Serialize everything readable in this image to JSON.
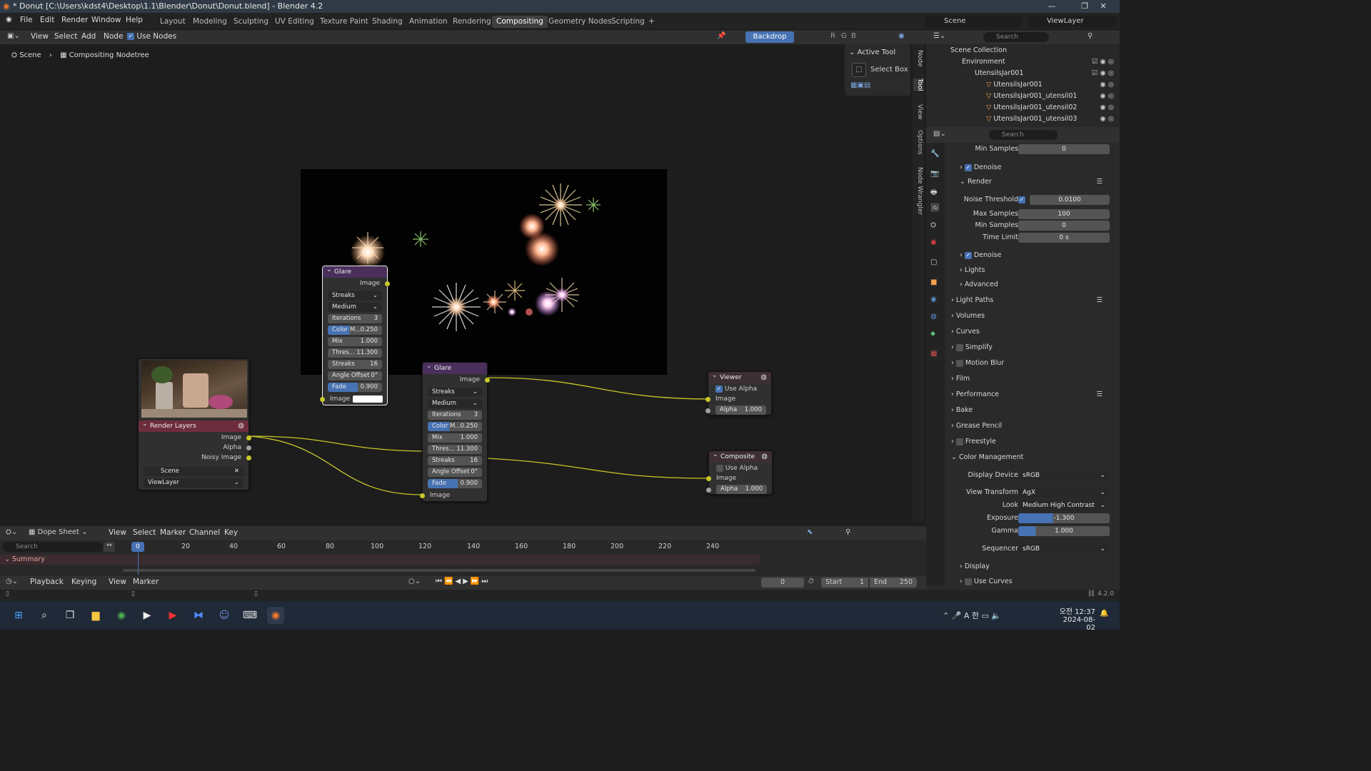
{
  "window": {
    "title": "* Donut [C:\\Users\\kdst4\\Desktop\\1.1\\Blender\\Donut\\Donut.blend] - Blender 4.2"
  },
  "menu": [
    "File",
    "Edit",
    "Render",
    "Window",
    "Help"
  ],
  "workspaces": [
    "Layout",
    "Modeling",
    "Sculpting",
    "UV Editing",
    "Texture Paint",
    "Shading",
    "Animation",
    "Rendering",
    "Compositing",
    "Geometry Nodes",
    "Scripting"
  ],
  "active_workspace": "Compositing",
  "scene_field": "Scene",
  "viewlayer_field": "ViewLayer",
  "editor_header": {
    "view": "View",
    "select": "Select",
    "add": "Add",
    "node": "Node",
    "use_nodes": "Use Nodes",
    "backdrop": "Backdrop",
    "channels": [
      "R",
      "G",
      "B"
    ]
  },
  "breadcrumb": {
    "scene": "Scene",
    "tree": "Compositing Nodetree"
  },
  "active_tool": {
    "title": "Active Tool",
    "tool": "Select Box"
  },
  "side_tabs": [
    "Node",
    "Tool",
    "View",
    "Options",
    "Node Wrangler"
  ],
  "glare_node": {
    "title": "Glare",
    "output": "Image",
    "type": "Streaks",
    "quality": "Medium",
    "fields": [
      {
        "label": "Iterations",
        "value": "3"
      },
      {
        "label": "Color M...",
        "value": "0.250",
        "blue": true
      },
      {
        "label": "Mix",
        "value": "1.000"
      },
      {
        "label": "Thres...",
        "value": "11.300"
      },
      {
        "label": "Streaks",
        "value": "16"
      },
      {
        "label": "Angle Offset",
        "value": "0°"
      },
      {
        "label": "Fade",
        "value": "0.900",
        "blue": true
      }
    ],
    "input": "Image"
  },
  "render_layers": {
    "title": "Render Layers",
    "outputs": [
      "Image",
      "Alpha",
      "Noisy Image"
    ],
    "scene": "Scene",
    "layer": "ViewLayer"
  },
  "viewer": {
    "title": "Viewer",
    "use_alpha": "Use Alpha",
    "image": "Image",
    "alpha_label": "Alpha",
    "alpha": "1.000"
  },
  "composite": {
    "title": "Composite",
    "use_alpha": "Use Alpha",
    "image": "Image",
    "alpha_label": "Alpha",
    "alpha": "1.000"
  },
  "outliner": {
    "search": "Search",
    "rows": [
      {
        "name": "Scene Collection"
      },
      {
        "name": "Environment"
      },
      {
        "name": "UtensilsJar001"
      },
      {
        "name": "UtensilsJar001"
      },
      {
        "name": "UtensilsJar001_utensil01"
      },
      {
        "name": "UtensilsJar001_utensil02"
      },
      {
        "name": "UtensilsJar001_utensil03"
      }
    ]
  },
  "properties": {
    "search": "Search",
    "rows": [
      {
        "label": "Min Samples",
        "value": "0"
      },
      {
        "label": "Denoise",
        "type": "check"
      },
      {
        "label": "Render",
        "type": "section"
      },
      {
        "label": "Noise Threshold",
        "value": "0.0100"
      },
      {
        "label": "Max Samples",
        "value": "100"
      },
      {
        "label": "Min Samples",
        "value": "0"
      },
      {
        "label": "Time Limit",
        "value": "0 s"
      },
      {
        "label": "Denoise",
        "type": "check"
      },
      {
        "label": "Lights",
        "type": "sub"
      },
      {
        "label": "Advanced",
        "type": "sub"
      },
      {
        "label": "Light Paths",
        "type": "panel"
      },
      {
        "label": "Volumes",
        "type": "panel"
      },
      {
        "label": "Curves",
        "type": "panel"
      },
      {
        "label": "Simplify",
        "type": "panelcb"
      },
      {
        "label": "Motion Blur",
        "type": "panelcb"
      },
      {
        "label": "Film",
        "type": "panel"
      },
      {
        "label": "Performance",
        "type": "panel"
      },
      {
        "label": "Bake",
        "type": "panel"
      },
      {
        "label": "Grease Pencil",
        "type": "panel"
      },
      {
        "label": "Freestyle",
        "type": "panelcb"
      },
      {
        "label": "Color Management",
        "type": "panelopen"
      }
    ],
    "color_management": {
      "display_device_label": "Display Device",
      "display_device": "sRGB",
      "view_transform_label": "View Transform",
      "view_transform": "AgX",
      "look_label": "Look",
      "look": "Medium High Contrast",
      "exposure_label": "Exposure",
      "exposure": "-1.300",
      "gamma_label": "Gamma",
      "gamma": "1.000",
      "sequencer_label": "Sequencer",
      "sequencer": "sRGB",
      "display": "Display",
      "use_curves": "Use Curves"
    }
  },
  "dopesheet": {
    "mode": "Dope Sheet",
    "menus": [
      "View",
      "Select",
      "Marker",
      "Channel",
      "Key"
    ],
    "search": "Search",
    "summary": "Summary",
    "frames": [
      "0",
      "20",
      "40",
      "60",
      "80",
      "100",
      "120",
      "140",
      "160",
      "180",
      "200",
      "220",
      "240"
    ],
    "current_frame": "0"
  },
  "timeline": {
    "menus": [
      "Playback",
      "Keying",
      "View",
      "Marker"
    ],
    "frame": "0",
    "start_label": "Start",
    "start": "1",
    "end_label": "End",
    "end": "250"
  },
  "status": {
    "version": "4.2.0"
  },
  "clock": {
    "time": "오전 12:37",
    "date": "2024-08-02"
  }
}
